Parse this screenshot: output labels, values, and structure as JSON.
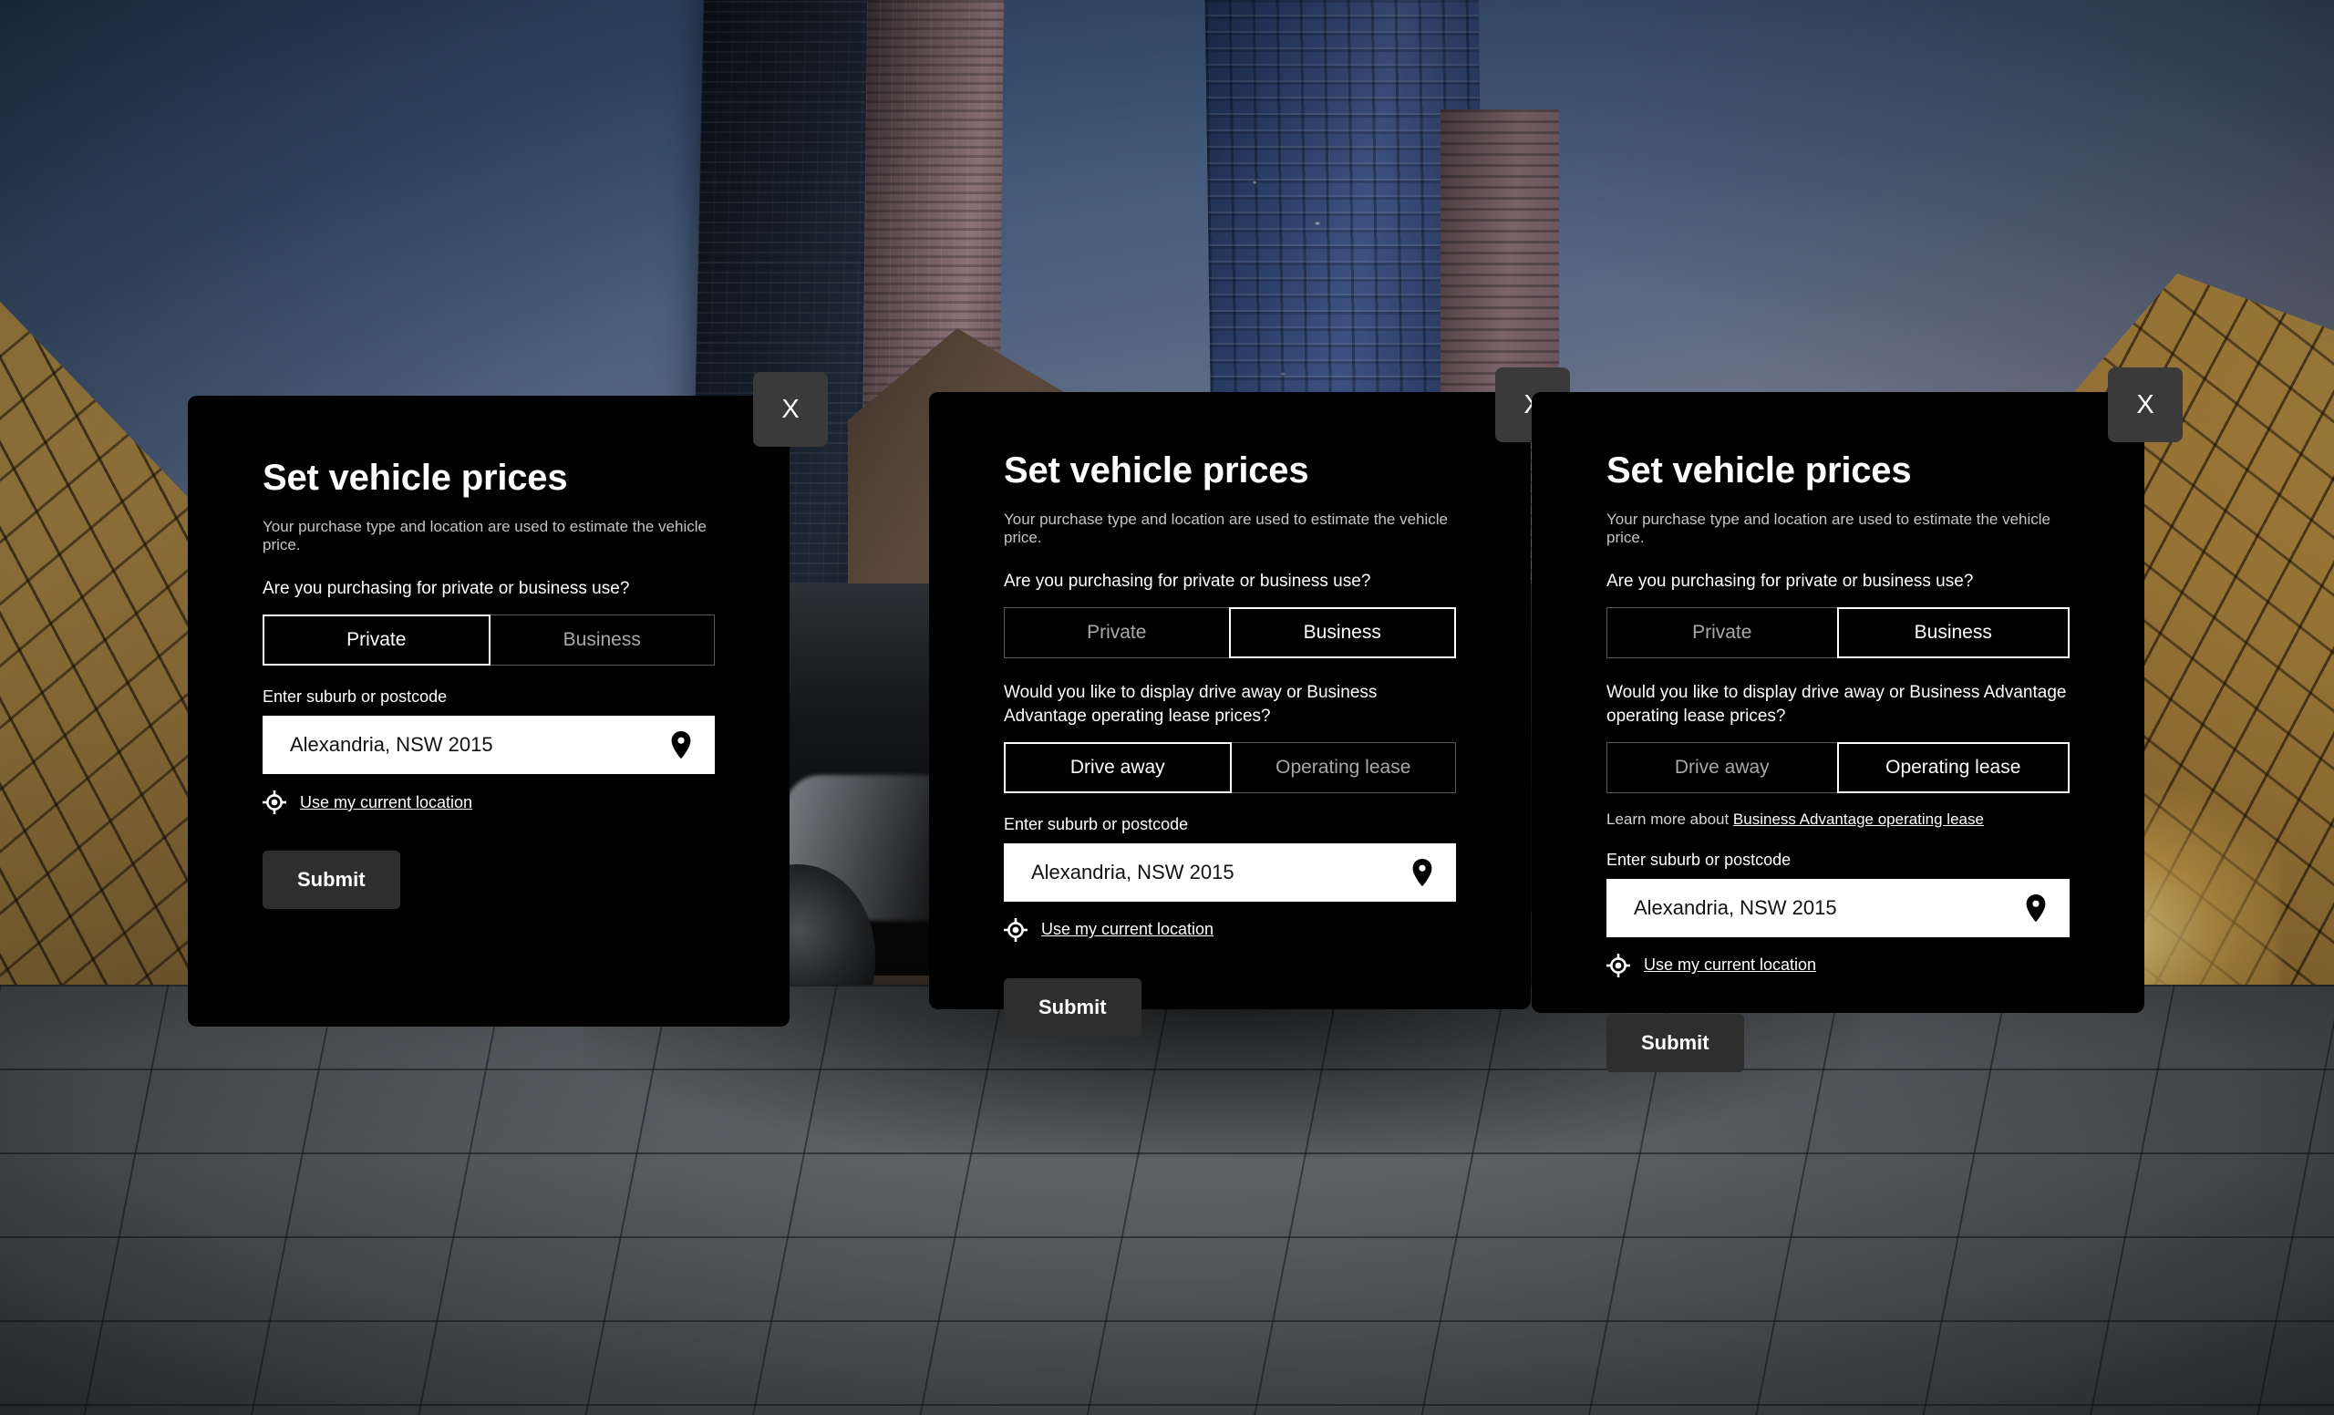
{
  "background": {
    "scene_description": "City plaza at dusk with glass-roofed buildings, skyscrapers and a dark vehicle on tiled pavement"
  },
  "modals": [
    {
      "id": "modal-1",
      "close_label": "X",
      "title": "Set vehicle prices",
      "subtitle": "Your purchase type and location are used to estimate the vehicle price.",
      "purchase_question": "Are you purchasing for private or business use?",
      "purchase_options": [
        {
          "label": "Private",
          "selected": true
        },
        {
          "label": "Business",
          "selected": false
        }
      ],
      "show_price_type": false,
      "price_type_question": "",
      "price_type_options": [],
      "show_learn_more": false,
      "learn_more_prefix": "",
      "learn_more_link": "",
      "location_label": "Enter suburb or postcode",
      "location_value": "Alexandria, NSW 2015",
      "location_placeholder": "Enter suburb or postcode",
      "locate_link": "Use my current location",
      "submit_label": "Submit"
    },
    {
      "id": "modal-2",
      "close_label": "X",
      "title": "Set vehicle prices",
      "subtitle": "Your purchase type and location are used to estimate the vehicle price.",
      "purchase_question": "Are you purchasing for private or business use?",
      "purchase_options": [
        {
          "label": "Private",
          "selected": false
        },
        {
          "label": "Business",
          "selected": true
        }
      ],
      "show_price_type": true,
      "price_type_question": "Would you like to display drive away or Business Advantage operating lease prices?",
      "price_type_options": [
        {
          "label": "Drive away",
          "selected": true
        },
        {
          "label": "Operating lease",
          "selected": false
        }
      ],
      "show_learn_more": false,
      "learn_more_prefix": "",
      "learn_more_link": "",
      "location_label": "Enter suburb or postcode",
      "location_value": "Alexandria, NSW 2015",
      "location_placeholder": "Enter suburb or postcode",
      "locate_link": "Use my current location",
      "submit_label": "Submit"
    },
    {
      "id": "modal-3",
      "close_label": "X",
      "title": "Set vehicle prices",
      "subtitle": "Your purchase type and location are used to estimate the vehicle price.",
      "purchase_question": "Are you purchasing for private or business use?",
      "purchase_options": [
        {
          "label": "Private",
          "selected": false
        },
        {
          "label": "Business",
          "selected": true
        }
      ],
      "show_price_type": true,
      "price_type_question": "Would you like to display drive away or Business Advantage operating lease prices?",
      "price_type_options": [
        {
          "label": "Drive away",
          "selected": false
        },
        {
          "label": "Operating lease",
          "selected": true
        }
      ],
      "show_learn_more": true,
      "learn_more_prefix": "Learn more about ",
      "learn_more_link": "Business Advantage operating lease",
      "location_label": "Enter suburb or postcode",
      "location_value": "Alexandria, NSW 2015",
      "location_placeholder": "Enter suburb or postcode",
      "locate_link": "Use my current location",
      "submit_label": "Submit"
    }
  ],
  "colors": {
    "modal_background": "#000000",
    "close_button_background": "#3a3a3a",
    "submit_button_background": "#2e2e2e",
    "selected_border": "#ffffff",
    "unselected_border": "#5a5a5a",
    "unselected_text": "#a8a8a8",
    "subtitle_text": "#c4c4c4",
    "input_background": "#ffffff",
    "input_text": "#111111"
  },
  "icons": {
    "close": "close-icon",
    "location_pin": "map-pin-icon",
    "locate_me": "crosshair-icon"
  }
}
